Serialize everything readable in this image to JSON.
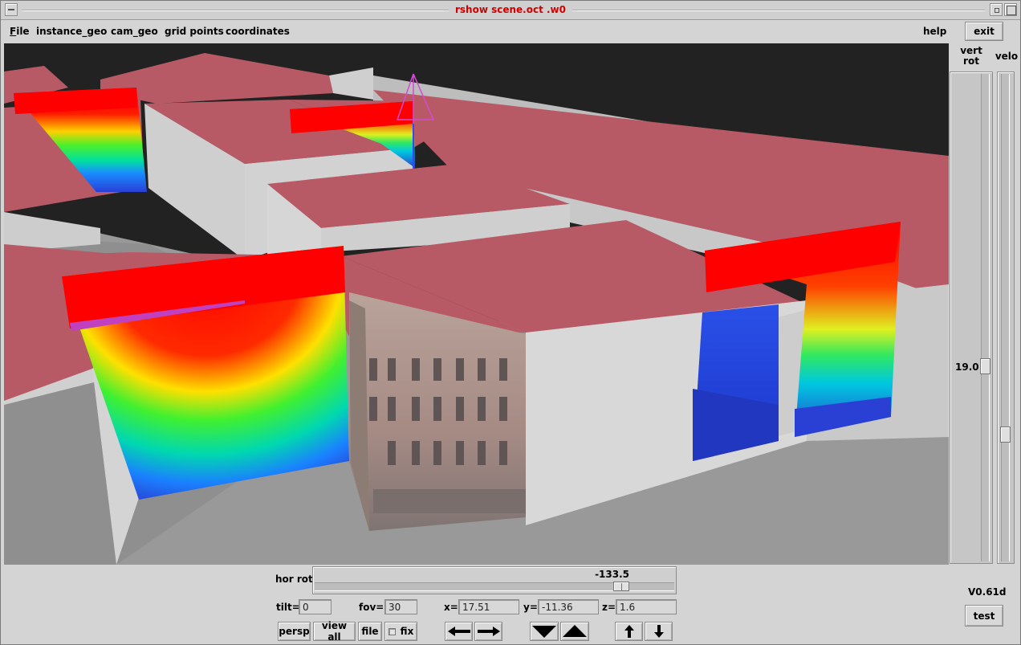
{
  "window": {
    "title": "rshow scene.oct .w0"
  },
  "menu": {
    "file_initial": "F",
    "file_rest": "ile",
    "instance_geo": "instance_geo",
    "cam_geo": "cam_geo",
    "grid_points": "grid points",
    "coordinates": "coordinates",
    "help": "help"
  },
  "buttons": {
    "exit": "exit",
    "test": "test",
    "persp": "persp",
    "view_all": "view all",
    "file": "file",
    "fix": "fix"
  },
  "sliders": {
    "vert_rot": {
      "label_line1": "vert",
      "label_line2": "rot",
      "value": "19.0"
    },
    "velo": {
      "label": "velo"
    },
    "hor_rot": {
      "label": "hor rot",
      "value": "-133.5"
    }
  },
  "fields": {
    "tilt": {
      "label": "tilt=",
      "value": "0"
    },
    "fov": {
      "label": "fov=",
      "value": "30"
    },
    "x": {
      "label": "x=",
      "value": "17.51"
    },
    "y": {
      "label": "y=",
      "value": "-11.36"
    },
    "z": {
      "label": "z=",
      "value": "1.6"
    }
  },
  "fix_checked": false,
  "version": "V0.61d",
  "colors": {
    "title_text": "#d00000",
    "roof": "#b85a66",
    "wall": "#d6d6d6",
    "ground": "#999999",
    "background": "#222222"
  },
  "icons": {
    "left_arrow": "arrow-left-icon",
    "right_arrow": "arrow-right-icon",
    "down_triangle": "triangle-down-icon",
    "up_triangle": "triangle-up-icon",
    "up_small_arrow": "arrow-up-icon",
    "down_small_arrow": "arrow-down-icon"
  }
}
